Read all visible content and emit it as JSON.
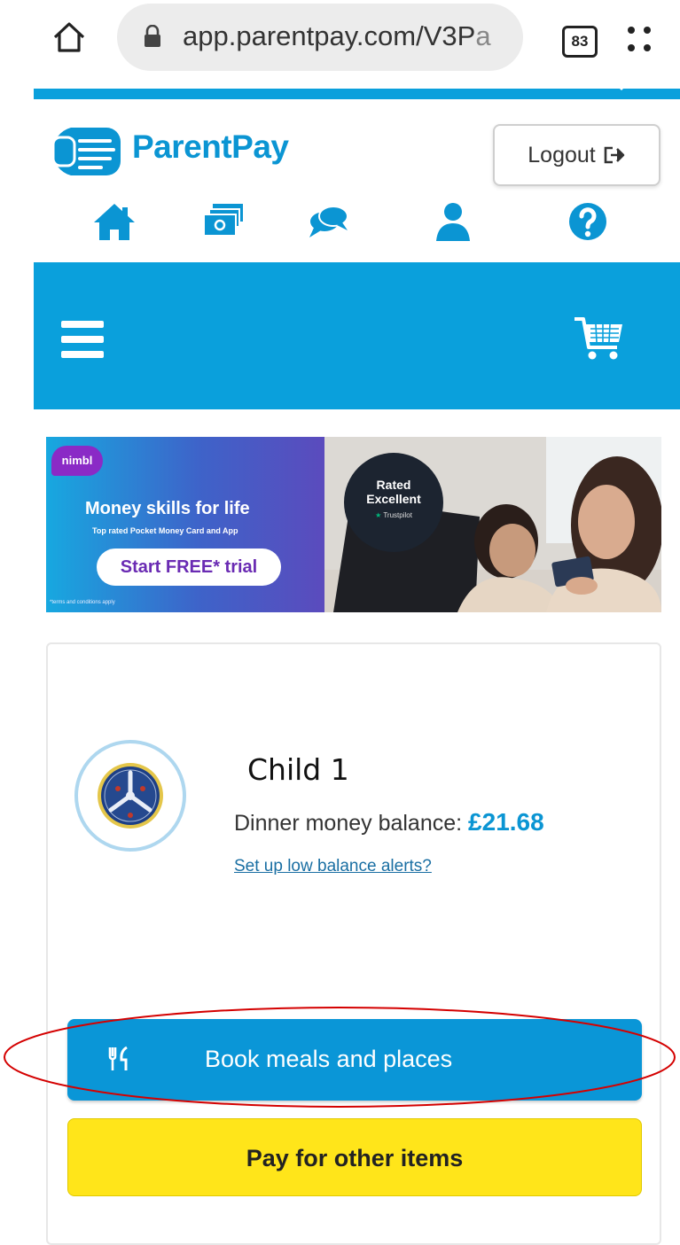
{
  "browser": {
    "url_main": "app.parentpay.com/V3P",
    "url_fade": "a",
    "tab_count": "83",
    "icons": [
      "home-icon",
      "lock-icon",
      "tab-switcher-icon",
      "menu-dots-icon"
    ]
  },
  "header": {
    "brand": "ParentPay",
    "logout_label": "Logout",
    "nav_icons": [
      "home-icon",
      "payments-icon",
      "messages-icon",
      "profile-icon",
      "help-icon"
    ]
  },
  "toolbar": {
    "icons": [
      "menu-icon",
      "basket-icon"
    ]
  },
  "ad": {
    "badge": "nimbl",
    "headline": "Money skills for life",
    "subline": "Top rated Pocket Money Card and App",
    "cta": "Start FREE* trial",
    "terms": "*terms and conditions apply",
    "rated_line1": "Rated",
    "rated_line2": "Excellent",
    "trustpilot": "Trustpilot"
  },
  "child": {
    "name": "Child 1",
    "balance_label": "Dinner money balance:",
    "balance_amount": "£21.68",
    "alerts_link": "Set up low balance alerts?"
  },
  "actions": {
    "book_label": "Book meals and places",
    "pay_label": "Pay for other items"
  },
  "colors": {
    "brand_blue": "#0aa0dc",
    "book_button": "#0a96d7",
    "pay_button": "#ffe51a",
    "annotation": "#d40000"
  }
}
